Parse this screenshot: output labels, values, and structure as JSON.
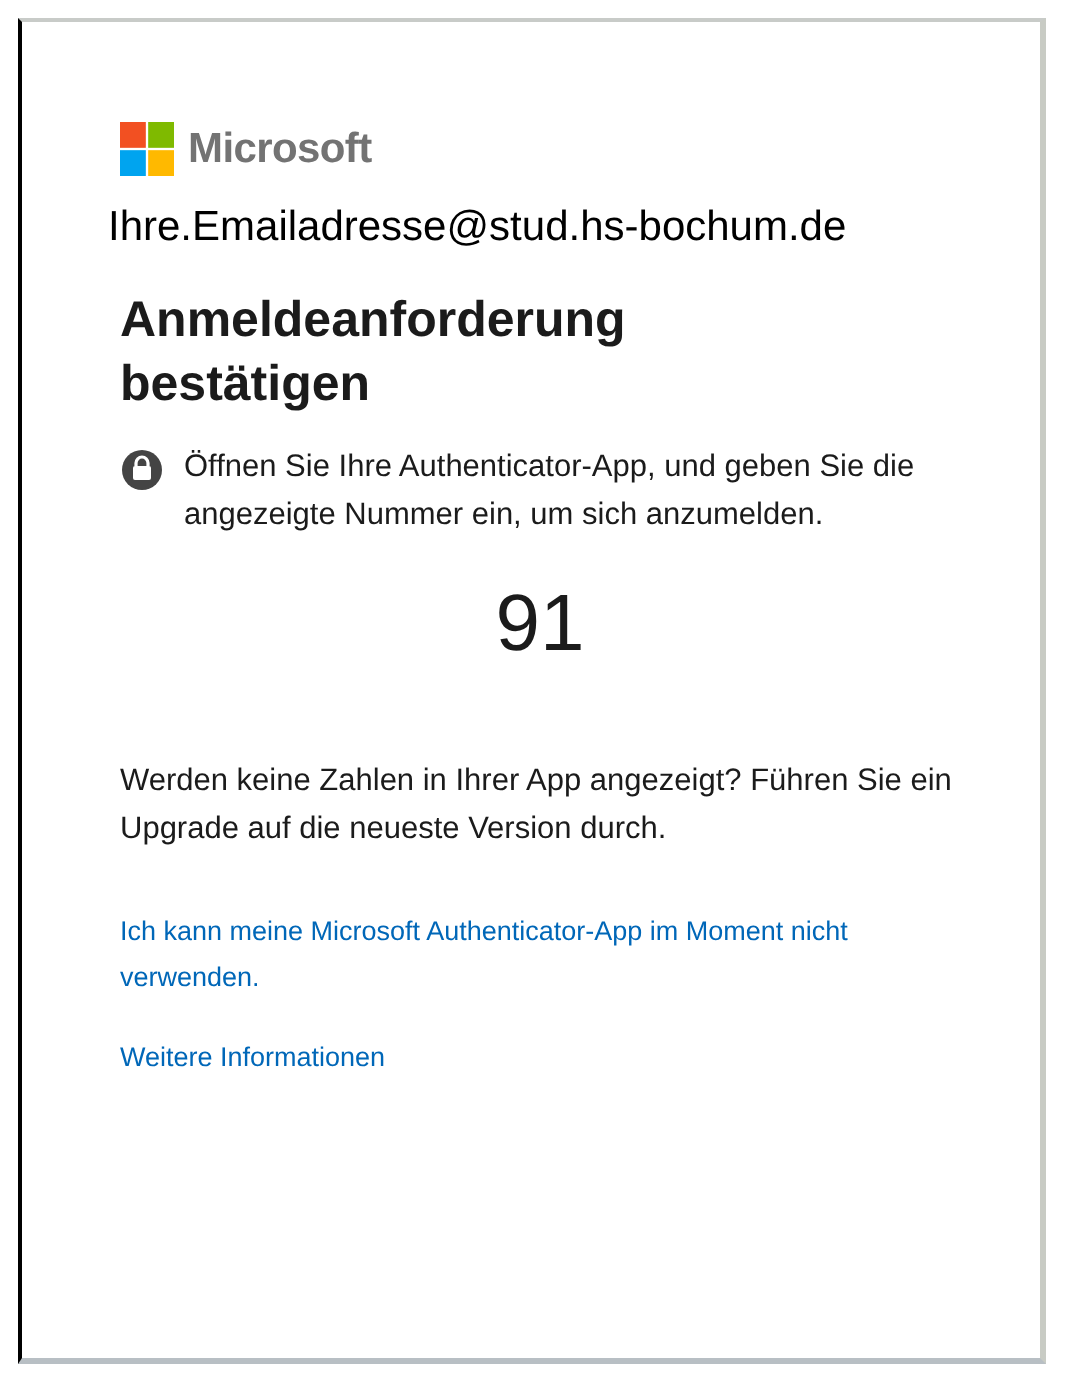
{
  "brand": "Microsoft",
  "email": "Ihre.Emailadresse@stud.hs-bochum.de",
  "title": "Anmeldeanforderung bestätigen",
  "instruction": "Öffnen Sie Ihre Authenticator-App, und geben Sie die angezeigte Nummer ein, um sich anzumelden.",
  "number": "91",
  "upgrade_hint": "Werden keine Zahlen in Ihrer App angezeigt? Führen Sie ein Upgrade auf die neueste Version durch.",
  "links": [
    "Ich kann meine Microsoft Authenticator-App im Moment nicht verwenden.",
    "Weitere Informationen"
  ]
}
